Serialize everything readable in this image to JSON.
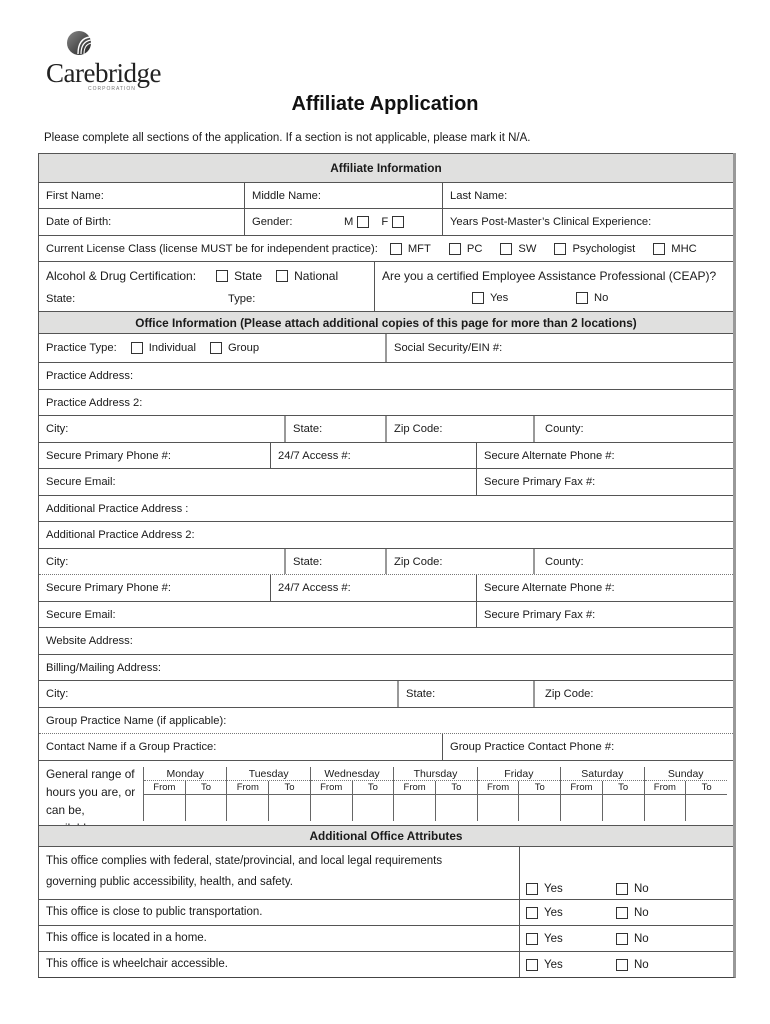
{
  "brand": {
    "name": "Carebridge",
    "subline": "CORPORATION",
    "logo_icon": "arched-bridge-emblem-icon"
  },
  "title": "Affiliate Application",
  "intro": "Please complete all sections of the application.  If a section is not applicable, please mark it N/A.",
  "colors": {
    "section_header_bg": "#e0e0df",
    "border": "#555555"
  },
  "affiliate": {
    "header": "Affiliate Information",
    "first_name": "First Name:",
    "middle_name": "Middle Name:",
    "last_name": "Last Name:",
    "dob": "Date of Birth:",
    "gender": "Gender:",
    "gender_m": "M",
    "gender_f": "F",
    "years_exp": "Years Post-Master’s Clinical Experience:",
    "license_label": "Current License Class (license MUST be for independent practice):",
    "license_options": [
      "MFT",
      "PC",
      "SW",
      "Psychologist",
      "MHC"
    ],
    "adc_label": "Alcohol & Drug Certification:",
    "adc_options": [
      "State",
      "National"
    ],
    "adc_state": "State:",
    "adc_type": "Type:",
    "ceap_question": "Are you a certified Employee Assistance Professional (CEAP)?",
    "ceap_yes": "Yes",
    "ceap_no": "No"
  },
  "office": {
    "header": "Office Information (Please attach additional copies of this page for more than 2 locations)",
    "practice_type": "Practice Type:",
    "practice_type_options": [
      "Individual",
      "Group"
    ],
    "ssn_ein": "Social Security/EIN #:",
    "practice_address": "Practice Address:",
    "practice_address_2": "Practice Address 2:",
    "city": "City:",
    "state": "State:",
    "zip": "Zip Code:",
    "county": "County:",
    "primary_phone": "Secure Primary Phone #:",
    "access_247": "24/7 Access #:",
    "alt_phone": "Secure Alternate Phone #:",
    "email": "Secure Email:",
    "fax": "Secure Primary Fax #:",
    "add_practice_address": "Additional Practice Address :",
    "add_practice_address_2": "Additional Practice Address 2:",
    "website": "Website Address:",
    "billing_address": "Billing/Mailing Address:",
    "group_name": "Group Practice Name (if applicable):",
    "contact_name": "Contact Name if a Group Practice:",
    "contact_phone": "Group Practice Contact Phone #:",
    "hours_label": "General range of hours you are, or can be, available.",
    "days": [
      "Monday",
      "Tuesday",
      "Wednesday",
      "Thursday",
      "Friday",
      "Saturday",
      "Sunday"
    ],
    "from": "From",
    "to": "To"
  },
  "attributes": {
    "header": "Additional Office Attributes",
    "yes": "Yes",
    "no": "No",
    "questions": [
      "This office complies with federal, state/provincial, and local legal requirements governing public accessibility, health, and safety.",
      "This office is close to public transportation.",
      "This office is located in a home.",
      "This office is wheelchair accessible."
    ]
  }
}
